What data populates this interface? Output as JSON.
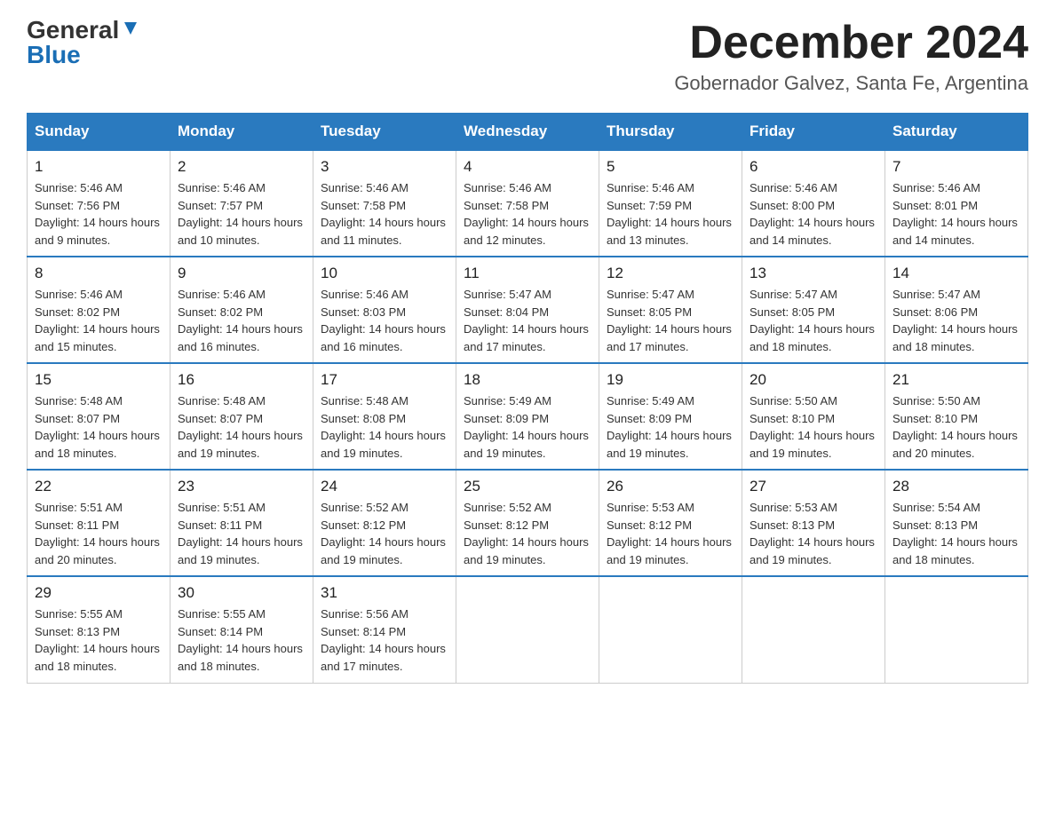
{
  "logo": {
    "general": "General",
    "blue": "Blue"
  },
  "title": "December 2024",
  "location": "Gobernador Galvez, Santa Fe, Argentina",
  "headers": [
    "Sunday",
    "Monday",
    "Tuesday",
    "Wednesday",
    "Thursday",
    "Friday",
    "Saturday"
  ],
  "weeks": [
    [
      {
        "day": "1",
        "sunrise": "5:46 AM",
        "sunset": "7:56 PM",
        "daylight": "14 hours and 9 minutes."
      },
      {
        "day": "2",
        "sunrise": "5:46 AM",
        "sunset": "7:57 PM",
        "daylight": "14 hours and 10 minutes."
      },
      {
        "day": "3",
        "sunrise": "5:46 AM",
        "sunset": "7:58 PM",
        "daylight": "14 hours and 11 minutes."
      },
      {
        "day": "4",
        "sunrise": "5:46 AM",
        "sunset": "7:58 PM",
        "daylight": "14 hours and 12 minutes."
      },
      {
        "day": "5",
        "sunrise": "5:46 AM",
        "sunset": "7:59 PM",
        "daylight": "14 hours and 13 minutes."
      },
      {
        "day": "6",
        "sunrise": "5:46 AM",
        "sunset": "8:00 PM",
        "daylight": "14 hours and 14 minutes."
      },
      {
        "day": "7",
        "sunrise": "5:46 AM",
        "sunset": "8:01 PM",
        "daylight": "14 hours and 14 minutes."
      }
    ],
    [
      {
        "day": "8",
        "sunrise": "5:46 AM",
        "sunset": "8:02 PM",
        "daylight": "14 hours and 15 minutes."
      },
      {
        "day": "9",
        "sunrise": "5:46 AM",
        "sunset": "8:02 PM",
        "daylight": "14 hours and 16 minutes."
      },
      {
        "day": "10",
        "sunrise": "5:46 AM",
        "sunset": "8:03 PM",
        "daylight": "14 hours and 16 minutes."
      },
      {
        "day": "11",
        "sunrise": "5:47 AM",
        "sunset": "8:04 PM",
        "daylight": "14 hours and 17 minutes."
      },
      {
        "day": "12",
        "sunrise": "5:47 AM",
        "sunset": "8:05 PM",
        "daylight": "14 hours and 17 minutes."
      },
      {
        "day": "13",
        "sunrise": "5:47 AM",
        "sunset": "8:05 PM",
        "daylight": "14 hours and 18 minutes."
      },
      {
        "day": "14",
        "sunrise": "5:47 AM",
        "sunset": "8:06 PM",
        "daylight": "14 hours and 18 minutes."
      }
    ],
    [
      {
        "day": "15",
        "sunrise": "5:48 AM",
        "sunset": "8:07 PM",
        "daylight": "14 hours and 18 minutes."
      },
      {
        "day": "16",
        "sunrise": "5:48 AM",
        "sunset": "8:07 PM",
        "daylight": "14 hours and 19 minutes."
      },
      {
        "day": "17",
        "sunrise": "5:48 AM",
        "sunset": "8:08 PM",
        "daylight": "14 hours and 19 minutes."
      },
      {
        "day": "18",
        "sunrise": "5:49 AM",
        "sunset": "8:09 PM",
        "daylight": "14 hours and 19 minutes."
      },
      {
        "day": "19",
        "sunrise": "5:49 AM",
        "sunset": "8:09 PM",
        "daylight": "14 hours and 19 minutes."
      },
      {
        "day": "20",
        "sunrise": "5:50 AM",
        "sunset": "8:10 PM",
        "daylight": "14 hours and 19 minutes."
      },
      {
        "day": "21",
        "sunrise": "5:50 AM",
        "sunset": "8:10 PM",
        "daylight": "14 hours and 20 minutes."
      }
    ],
    [
      {
        "day": "22",
        "sunrise": "5:51 AM",
        "sunset": "8:11 PM",
        "daylight": "14 hours and 20 minutes."
      },
      {
        "day": "23",
        "sunrise": "5:51 AM",
        "sunset": "8:11 PM",
        "daylight": "14 hours and 19 minutes."
      },
      {
        "day": "24",
        "sunrise": "5:52 AM",
        "sunset": "8:12 PM",
        "daylight": "14 hours and 19 minutes."
      },
      {
        "day": "25",
        "sunrise": "5:52 AM",
        "sunset": "8:12 PM",
        "daylight": "14 hours and 19 minutes."
      },
      {
        "day": "26",
        "sunrise": "5:53 AM",
        "sunset": "8:12 PM",
        "daylight": "14 hours and 19 minutes."
      },
      {
        "day": "27",
        "sunrise": "5:53 AM",
        "sunset": "8:13 PM",
        "daylight": "14 hours and 19 minutes."
      },
      {
        "day": "28",
        "sunrise": "5:54 AM",
        "sunset": "8:13 PM",
        "daylight": "14 hours and 18 minutes."
      }
    ],
    [
      {
        "day": "29",
        "sunrise": "5:55 AM",
        "sunset": "8:13 PM",
        "daylight": "14 hours and 18 minutes."
      },
      {
        "day": "30",
        "sunrise": "5:55 AM",
        "sunset": "8:14 PM",
        "daylight": "14 hours and 18 minutes."
      },
      {
        "day": "31",
        "sunrise": "5:56 AM",
        "sunset": "8:14 PM",
        "daylight": "14 hours and 17 minutes."
      },
      null,
      null,
      null,
      null
    ]
  ]
}
